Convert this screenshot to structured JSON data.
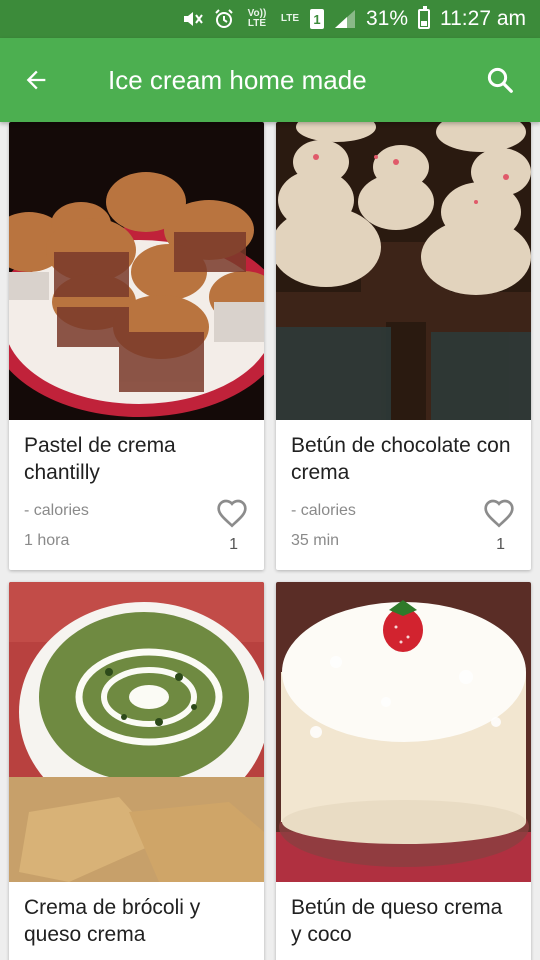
{
  "status_bar": {
    "volte_label": "Vo)) LTE",
    "lte_label": "LTE",
    "sim_label": "1",
    "battery_percent": "31%",
    "time": "11:27 am",
    "icons": [
      "mute-icon",
      "alarm-icon",
      "volte-icon",
      "lte-data-icon",
      "sim-icon",
      "signal-icon",
      "battery-charging-icon"
    ]
  },
  "app_bar": {
    "title": "Ice cream home made",
    "back_icon": "arrow-back-icon",
    "search_icon": "search-icon",
    "color": "#4caf50"
  },
  "recipes": [
    {
      "name": "Pastel de crema chantilly",
      "calories": "- calories",
      "time": "1 hora",
      "likes": "1",
      "image": "muffins-plate"
    },
    {
      "name": "Betún de chocolate con crema",
      "calories": "- calories",
      "time": "35 min",
      "likes": "1",
      "image": "chocolate-cupcakes-frosting"
    },
    {
      "name": "Crema de brócoli y queso crema",
      "image": "broccoli-soup-bowl"
    },
    {
      "name": "Betún de queso crema y coco",
      "image": "coconut-cake-strawberry"
    }
  ]
}
